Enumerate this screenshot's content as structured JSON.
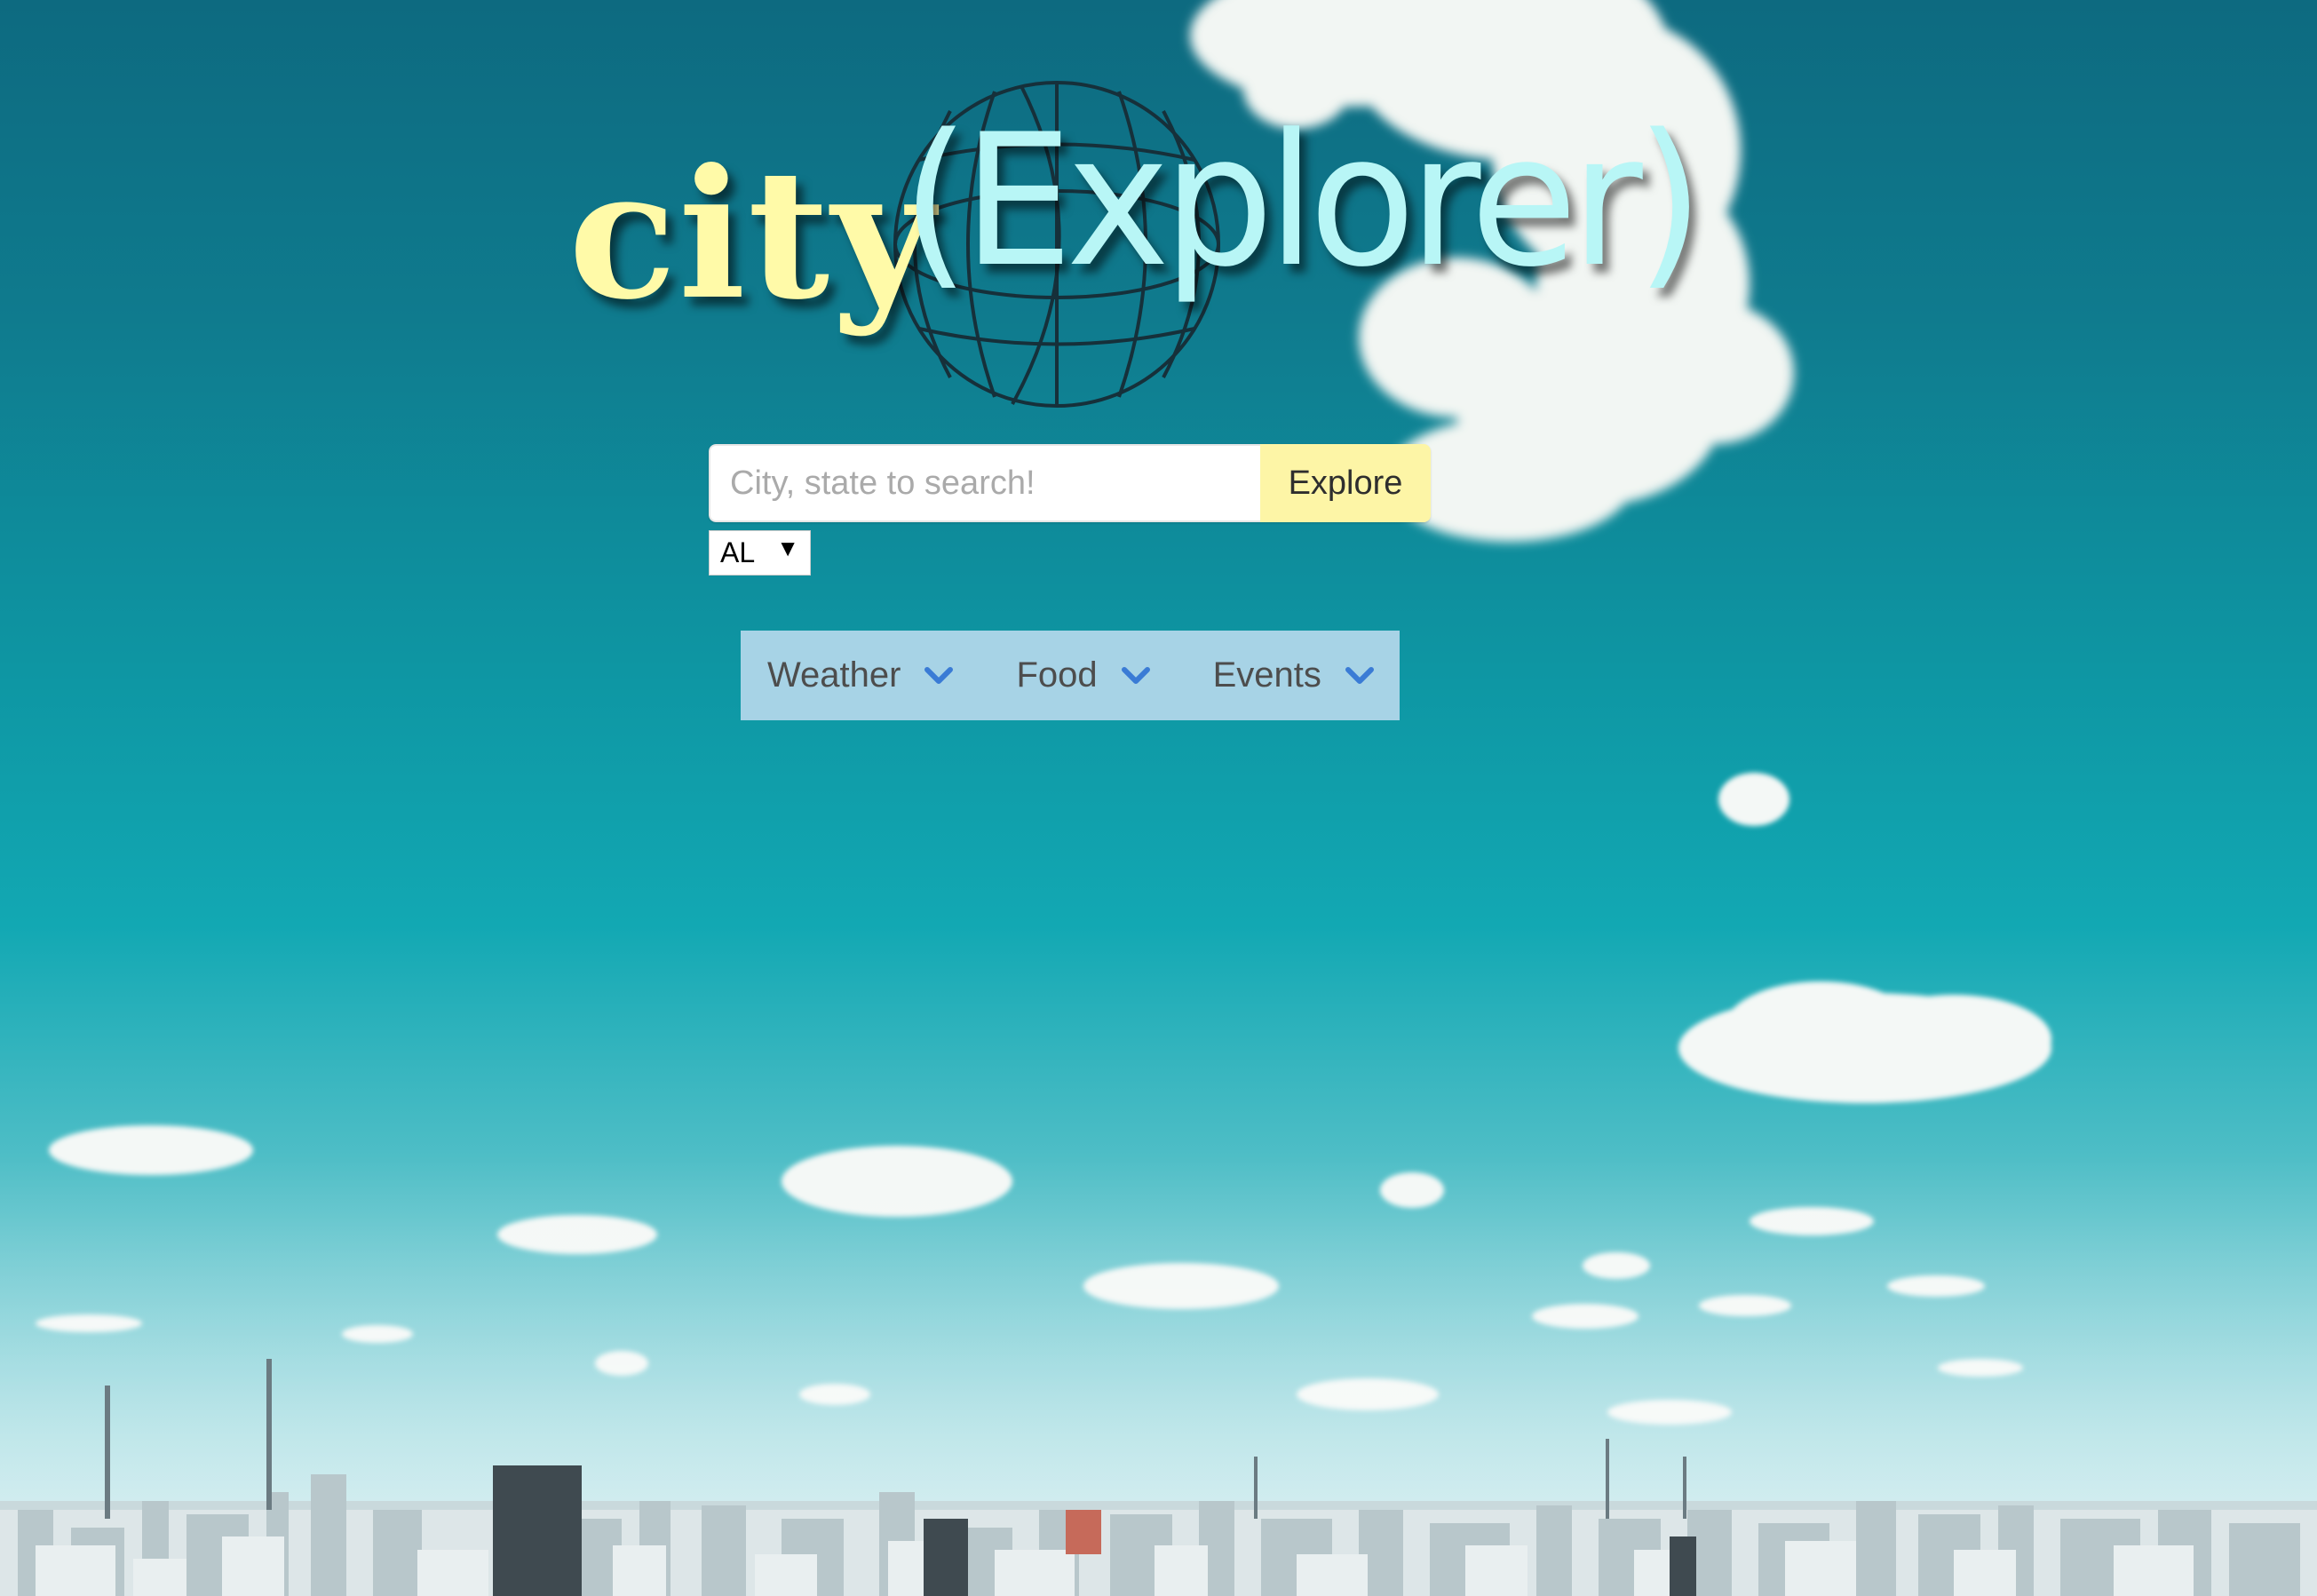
{
  "logo": {
    "word1": "city",
    "word2": "(Explorer)"
  },
  "search": {
    "placeholder": "City, state to search!",
    "value": "",
    "button_label": "Explore"
  },
  "state_select": {
    "selected": "AL"
  },
  "categories": [
    {
      "label": "Weather",
      "icon": "chevron-down-icon"
    },
    {
      "label": "Food",
      "icon": "chevron-down-icon"
    },
    {
      "label": "Events",
      "icon": "chevron-down-icon"
    }
  ],
  "colors": {
    "accent_yellow": "#fdf5a6",
    "logo_city": "#fffaa8",
    "logo_explorer": "#b8f6f6",
    "category_bar": "#a7d3e6",
    "chevron": "#3a7bd5"
  }
}
